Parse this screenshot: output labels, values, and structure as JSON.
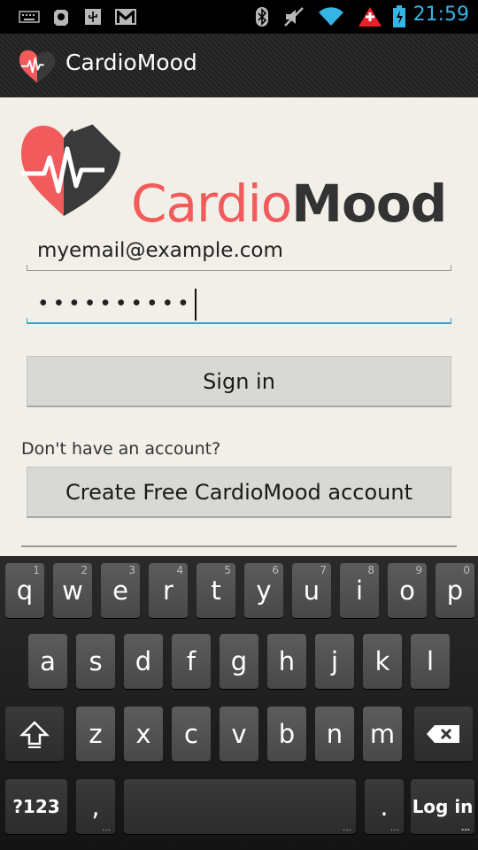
{
  "status_bar": {
    "time": "21:59",
    "icons": [
      "keyboard-icon",
      "bug-icon",
      "usb-icon",
      "gmail-icon",
      "bluetooth-icon",
      "mute-icon",
      "wifi-icon",
      "warning-icon",
      "battery-icon"
    ],
    "accent_color": "#33b5e5"
  },
  "action_bar": {
    "title": "CardioMood"
  },
  "brand": {
    "part1": "Cardio",
    "part2": "Mood",
    "colors": {
      "cardio": "#f15b5b",
      "mood": "#333333"
    }
  },
  "login": {
    "email_value": "myemail@example.com",
    "password_mask": "••••••••••",
    "sign_in_label": "Sign in",
    "no_account_text": "Don't have an account?",
    "create_account_label": "Create Free CardioMood account"
  },
  "keyboard": {
    "row1": [
      {
        "k": "q",
        "s": "1"
      },
      {
        "k": "w",
        "s": "2"
      },
      {
        "k": "e",
        "s": "3"
      },
      {
        "k": "r",
        "s": "4"
      },
      {
        "k": "t",
        "s": "5"
      },
      {
        "k": "y",
        "s": "6"
      },
      {
        "k": "u",
        "s": "7"
      },
      {
        "k": "i",
        "s": "8"
      },
      {
        "k": "o",
        "s": "9"
      },
      {
        "k": "p",
        "s": "0"
      }
    ],
    "row2": [
      "a",
      "s",
      "d",
      "f",
      "g",
      "h",
      "j",
      "k",
      "l"
    ],
    "row3": [
      "z",
      "x",
      "c",
      "v",
      "b",
      "n",
      "m"
    ],
    "symbols_label": "?123",
    "comma_label": ",",
    "period_label": ".",
    "action_label": "Log in"
  }
}
